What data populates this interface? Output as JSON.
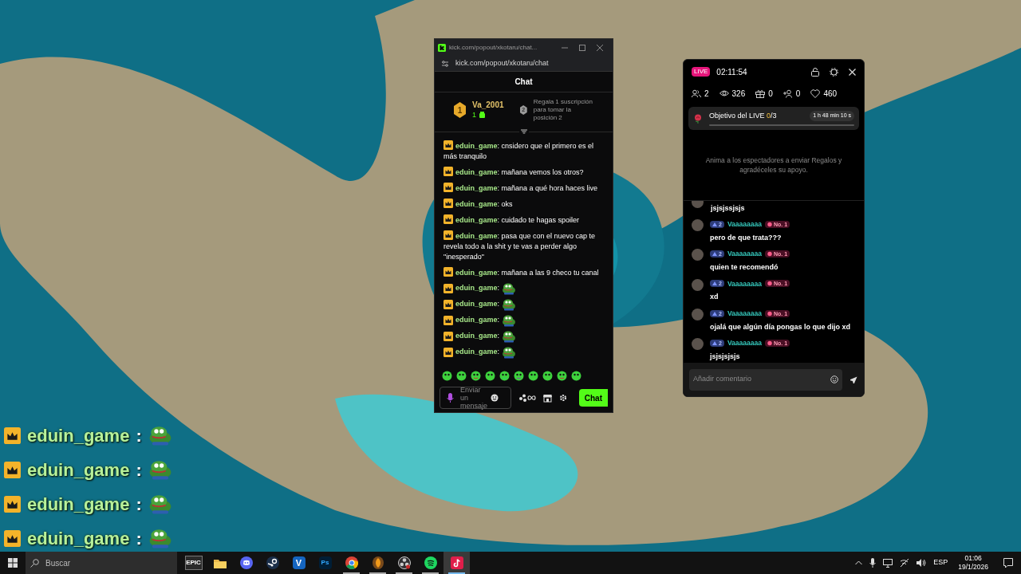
{
  "popup_window": {
    "title": "kick.com/popout/xkotaru/chat...",
    "address": "kick.com/popout/xkotaru/chat",
    "header": "Chat",
    "leaderboard": {
      "rank": "1",
      "user": "Va_2001",
      "count": "1",
      "next_rank": "2",
      "hint": "Regala 1 suscripción para tomar la posición 2"
    },
    "messages": [
      {
        "kind": "text",
        "user": "eduin_game",
        "separator": ":",
        "text": "cnsidero que el primero es el más tranquilo"
      },
      {
        "kind": "text",
        "user": "eduin_game",
        "separator": ":",
        "text": "mañana vemos los otros?"
      },
      {
        "kind": "text",
        "user": "eduin_game",
        "separator": ":",
        "text": "mañana a qué hora haces live"
      },
      {
        "kind": "text",
        "user": "eduin_game",
        "separator": ":",
        "text": "oks"
      },
      {
        "kind": "text",
        "user": "eduin_game",
        "separator": ":",
        "text": "cuidado te hagas spoiler"
      },
      {
        "kind": "text",
        "user": "eduin_game",
        "separator": ":",
        "text": "pasa que con el nuevo cap te revela todo a la shit y te vas a perder algo \"inesperado\""
      },
      {
        "kind": "text",
        "user": "eduin_game",
        "separator": ":",
        "text": "mañana a las 9 checo tu canal"
      },
      {
        "kind": "emote",
        "user": "eduin_game",
        "separator": ":"
      },
      {
        "kind": "emote",
        "user": "eduin_game",
        "separator": ":"
      },
      {
        "kind": "emote",
        "user": "eduin_game",
        "separator": ":"
      },
      {
        "kind": "emote",
        "user": "eduin_game",
        "separator": ":"
      },
      {
        "kind": "emote",
        "user": "eduin_game",
        "separator": ":"
      }
    ],
    "input": {
      "placeholder": "Enviar un mensaje"
    },
    "send_button": "Chat"
  },
  "live_panel": {
    "badge": "LIVE",
    "timer": "02:11:54",
    "stats": [
      {
        "kind": "people",
        "value": "2"
      },
      {
        "kind": "eye",
        "value": "326"
      },
      {
        "kind": "gift",
        "value": "0"
      },
      {
        "kind": "person-plus",
        "value": "0"
      },
      {
        "kind": "heart",
        "value": "460"
      }
    ],
    "goal": {
      "title": "Objetivo del LIVE",
      "current": "0",
      "total": "/3",
      "time_left": "1 h 48 min 10 s",
      "level": 0
    },
    "empty_hint": "Anima a los espectadores a enviar Regalos y agradéceles su apoyo.",
    "comments": [
      {
        "kind": "clipped",
        "text": "jsjsjssjsjs"
      },
      {
        "kind": "full",
        "level_badge": "2",
        "user": "Vaaaaaaaa",
        "rank_badge": "No. 1",
        "text": "pero de que trata???"
      },
      {
        "kind": "full",
        "level_badge": "2",
        "user": "Vaaaaaaaa",
        "rank_badge": "No. 1",
        "text": "quien te recomendó"
      },
      {
        "kind": "full",
        "level_badge": "2",
        "user": "Vaaaaaaaa",
        "rank_badge": "No. 1",
        "text": "xd"
      },
      {
        "kind": "full",
        "level_badge": "2",
        "user": "Vaaaaaaaa",
        "rank_badge": "No. 1",
        "text": "ojalá que algún día pongas lo que dijo xd"
      },
      {
        "kind": "full",
        "level_badge": "2",
        "user": "Vaaaaaaaa",
        "rank_badge": "No. 1",
        "text": "jsjsjsjsjs"
      }
    ],
    "comment_placeholder": "Añadir comentario"
  },
  "overlay_chat": [
    {
      "user": "eduin_game",
      "separator": ":"
    },
    {
      "user": "eduin_game",
      "separator": ":"
    },
    {
      "user": "eduin_game",
      "separator": ":"
    },
    {
      "user": "eduin_game",
      "separator": ":"
    }
  ],
  "taskbar": {
    "search_placeholder": "Buscar",
    "apps": [
      {
        "kind": "epic",
        "label": "EPIC",
        "running": false,
        "selected": false
      },
      {
        "kind": "folder",
        "running": false,
        "selected": false
      },
      {
        "kind": "discord",
        "running": false,
        "selected": false
      },
      {
        "kind": "steam",
        "running": false,
        "selected": false
      },
      {
        "kind": "letter",
        "label": "V",
        "running": false,
        "selected": false
      },
      {
        "kind": "ps",
        "label": "Ps",
        "running": false,
        "selected": false
      },
      {
        "kind": "chrome",
        "running": true,
        "selected": false
      },
      {
        "kind": "fl",
        "running": true,
        "selected": false
      },
      {
        "kind": "obs",
        "running": true,
        "selected": false
      },
      {
        "kind": "spotify",
        "running": true,
        "selected": false
      },
      {
        "kind": "tiktok",
        "running": true,
        "selected": true
      }
    ],
    "tray": {
      "language": "ESP",
      "time": "01:06",
      "date": "19/1/2026"
    }
  }
}
